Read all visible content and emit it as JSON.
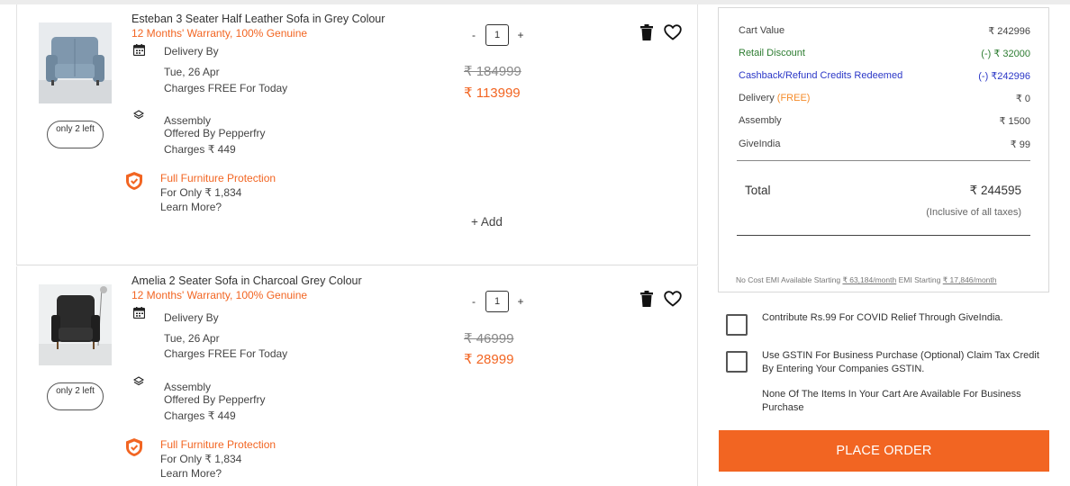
{
  "items": [
    {
      "name": "Esteban 3 Seater Half Leather Sofa in Grey Colour",
      "warranty": "12 Months' Warranty, 100% Genuine",
      "stock": "only 2 left",
      "delivery_label": "Delivery By",
      "delivery_date": "Tue, 26 Apr",
      "delivery_charges": "Charges FREE For Today",
      "assembly_label": "Assembly",
      "assembly_by": "Offered By Pepperfry",
      "assembly_charges": "Charges ₹ 449",
      "protection_title": "Full Furniture Protection",
      "protection_price": "For Only ₹ 1,834",
      "protection_more": "Learn More?",
      "qty_minus": "-",
      "qty": "1",
      "qty_plus": "+",
      "mrp": "₹ 184999",
      "price": "₹ 113999",
      "add_label": "+ Add",
      "image_icon": "grey-sofa-image"
    },
    {
      "name": "Amelia 2 Seater Sofa in Charcoal Grey Colour",
      "warranty": "12 Months' Warranty, 100% Genuine",
      "stock": "only 2 left",
      "delivery_label": "Delivery By",
      "delivery_date": "Tue, 26 Apr",
      "delivery_charges": "Charges FREE For Today",
      "assembly_label": "Assembly",
      "assembly_by": "Offered By Pepperfry",
      "assembly_charges": "Charges ₹ 449",
      "protection_title": "Full Furniture Protection",
      "protection_price": "For Only ₹ 1,834",
      "protection_more": "Learn More?",
      "qty_minus": "-",
      "qty": "1",
      "qty_plus": "+",
      "mrp": "₹ 46999",
      "price": "₹ 28999",
      "image_icon": "charcoal-chair-image"
    }
  ],
  "summary": {
    "cart_value_label": "Cart Value",
    "cart_value": "₹ 242996",
    "retail_discount_label": "Retail Discount",
    "retail_discount": "(-) ₹ 32000",
    "cashback_label": "Cashback/Refund Credits Redeemed",
    "cashback": "(-) ₹242996",
    "delivery_label": "Delivery",
    "delivery_free": "(FREE)",
    "delivery": "₹ 0",
    "assembly_label": "Assembly",
    "assembly": "₹ 1500",
    "giveindia_label": "GiveIndia",
    "giveindia": "₹ 99",
    "total_label": "Total",
    "total": "₹ 244595",
    "inclusive": "(Inclusive of all taxes)",
    "emi_prefix": "No Cost EMI Available Starting",
    "emi_link1": "₹ 63,184/month",
    "emi_mid": "EMI Starting",
    "emi_link2": "₹ 17,846/month"
  },
  "options": {
    "covid": "Contribute Rs.99 For COVID Relief Through GiveIndia.",
    "gstin": "Use GSTIN For Business Purchase (Optional) Claim Tax Credit By Entering Your Companies GSTIN.",
    "gstin_note": "None Of The Items In Your Cart Are Available For Business Purchase"
  },
  "place_order_label": "PLACE ORDER",
  "colors": {
    "accent": "#f26522",
    "discount": "#2e7d32",
    "cashback": "#2b37c7"
  }
}
